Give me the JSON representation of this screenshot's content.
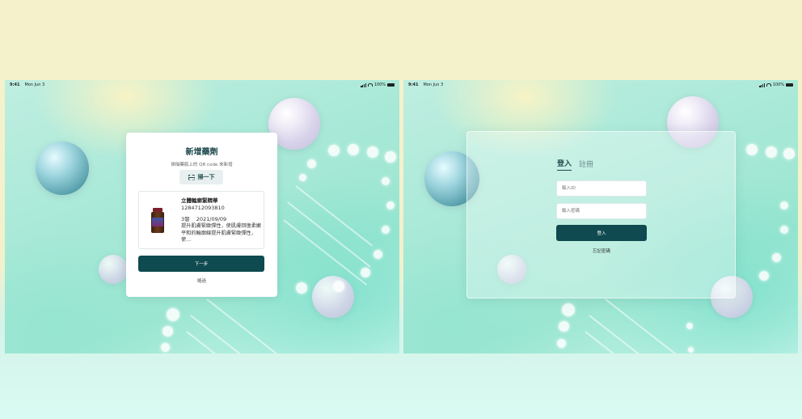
{
  "status_bar": {
    "time": "9:41",
    "date": "Mon Jun 3",
    "battery": "100%"
  },
  "add_medicine": {
    "title": "新增藥劑",
    "subtitle": "掃描藥瓶上的 QR code 來新增",
    "scan_button": "掃一下",
    "product": {
      "name": "立體輪廓緊精華",
      "code": "1284712093810",
      "quantity": "3發",
      "date": "2021/09/09",
      "description": "提升肌膚緊緻彈性，使肌膚回復柔嫩平和的輪廓線提升肌膚緊緻彈性，使..."
    },
    "next_button": "下一步",
    "skip_link": "略過"
  },
  "login": {
    "tabs": [
      "登入",
      "註冊"
    ],
    "active_tab": "登入",
    "id_placeholder": "輸入ID",
    "password_placeholder": "輸入密碼",
    "login_button": "登入",
    "forgot_link": "忘記密碼"
  }
}
